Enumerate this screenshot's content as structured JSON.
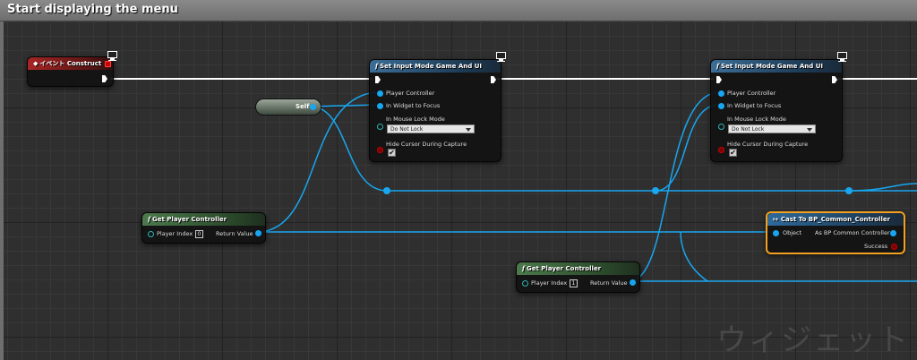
{
  "comment": {
    "title": "Start displaying the menu"
  },
  "event_node": {
    "title": "イベント Construct"
  },
  "self_node": {
    "label": "Self"
  },
  "set_input_nodes": [
    {
      "title": "Set Input Mode Game And UI",
      "player_controller_label": "Player Controller",
      "in_widget_label": "In Widget to Focus",
      "mouse_lock_label": "In Mouse Lock Mode",
      "mouse_lock_value": "Do Not Lock",
      "hide_cursor_label": "Hide Cursor During Capture",
      "hide_cursor_checked": "✔"
    },
    {
      "title": "Set Input Mode Game And UI",
      "player_controller_label": "Player Controller",
      "in_widget_label": "In Widget to Focus",
      "mouse_lock_label": "In Mouse Lock Mode",
      "mouse_lock_value": "Do Not Lock",
      "hide_cursor_label": "Hide Cursor During Capture",
      "hide_cursor_checked": "✔"
    }
  ],
  "get_player_nodes": [
    {
      "title": "Get Player Controller",
      "index_label": "Player Index",
      "index_value": "0",
      "return_label": "Return Value"
    },
    {
      "title": "Get Player Controller",
      "index_label": "Player Index",
      "index_value": "1",
      "return_label": "Return Value"
    }
  ],
  "cast_node": {
    "title": "Cast To BP_Common_Controller",
    "object_label": "Object",
    "as_label": "As BP Common Controller",
    "success_label": "Success"
  },
  "watermark": "ウィジェット",
  "colors": {
    "wire_data": "#18a6f0",
    "wire_exec": "#ffffff",
    "cast_highlight": "#f2a020",
    "comment_bar": "#7c7c7c"
  },
  "icons": [
    "function-icon",
    "event-icon",
    "monitor-icon",
    "cast-icon",
    "exec-pin-icon",
    "chevron-down-icon",
    "checkmark-icon"
  ]
}
